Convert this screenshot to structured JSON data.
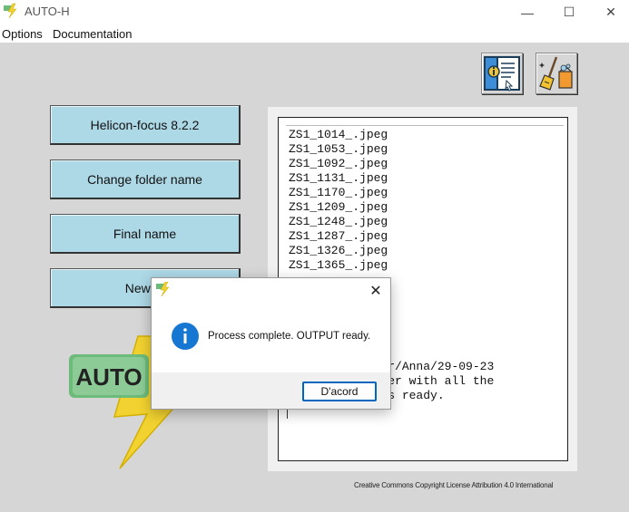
{
  "window": {
    "title": "AUTO-H",
    "minimize_glyph": "—",
    "maximize_glyph": "☐",
    "close_glyph": "✕"
  },
  "menu": {
    "options": "Options",
    "documentation": "Documentation"
  },
  "toolbar": {
    "doc_icon": "document-info-icon",
    "clean_icon": "cleaning-broom-icon"
  },
  "buttons": {
    "helicon": "Helicon-focus 8.2.2",
    "change_folder": "Change folder name",
    "final_name": "Final name",
    "new_folder": "New fo"
  },
  "logo": {
    "text": "AUTO",
    "icon": "lightning-bolt-icon"
  },
  "output": {
    "files": [
      "ZS1_1014_.jpeg",
      "ZS1_1053_.jpeg",
      "ZS1_1092_.jpeg",
      "ZS1_1131_.jpeg",
      "ZS1_1170_.jpeg",
      "ZS1_1209_.jpeg",
      "ZS1_1248_.jpeg",
      "ZS1_1287_.jpeg",
      "ZS1_1326_.jpeg",
      "ZS1_1365_.jpeg"
    ],
    "messages": [
      "ter/Anna/29-09-23",
      "lder with all the",
      " is ready."
    ]
  },
  "license": "Creative Commons Copyright License Attribution 4.0 International",
  "dialog": {
    "message": "Process complete. OUTPUT ready.",
    "ok_label": "D'acord",
    "close_glyph": "✕",
    "info_icon": "information-icon"
  },
  "colors": {
    "button_bg": "#add8e6",
    "window_bg": "#d6d6d6",
    "dialog_accent": "#0067c0",
    "logo_green": "#6dbb7a",
    "bolt_yellow": "#f2d230"
  }
}
